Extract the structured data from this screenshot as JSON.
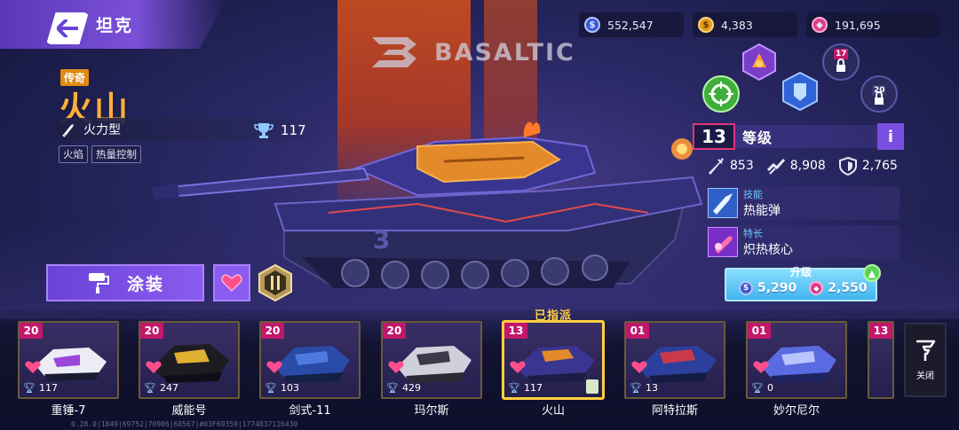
{
  "header": {
    "title": "坦克"
  },
  "brand": {
    "name": "BASALTIC"
  },
  "resources": [
    {
      "icon": "blue-coin-icon",
      "value": "552,547"
    },
    {
      "icon": "gold-coin-icon",
      "value": "4,383"
    },
    {
      "icon": "pink-gem-icon",
      "value": "191,695"
    }
  ],
  "tank": {
    "rarity": "传奇",
    "name": "火山",
    "class": "火力型",
    "trophies": "117",
    "tags": [
      "火焰",
      "热量控制"
    ],
    "level": "13",
    "level_label": "等级",
    "info_label": "i",
    "stats": {
      "attack": "853",
      "speed": "8,908",
      "armor": "2,765"
    },
    "skill": {
      "title": "技能",
      "name": "热能弹"
    },
    "trait": {
      "title": "特长",
      "name": "炽热核心"
    }
  },
  "actions": {
    "paint_label": "涂装"
  },
  "module_slots": {
    "slot17": "17",
    "slot20": "20"
  },
  "upgrade": {
    "label": "升级",
    "cost_blue": "5,290",
    "cost_pink": "2,550"
  },
  "garage": {
    "assigned_label": "已指派",
    "cards": [
      {
        "level": "20",
        "trophies": "117",
        "name": "重锤-7"
      },
      {
        "level": "20",
        "trophies": "247",
        "name": "威能号"
      },
      {
        "level": "20",
        "trophies": "103",
        "name": "剑式-11"
      },
      {
        "level": "20",
        "trophies": "429",
        "name": "玛尔斯"
      },
      {
        "level": "13",
        "trophies": "117",
        "name": "火山"
      },
      {
        "level": "01",
        "trophies": "13",
        "name": "阿特拉斯"
      },
      {
        "level": "01",
        "trophies": "0",
        "name": "妙尔尼尔"
      },
      {
        "level": "13",
        "trophies": "",
        "name": ""
      }
    ],
    "close_label": "关闭"
  },
  "version": "0.28.0|1849|69752|70906|68567|#03F69359|1774837116430"
}
